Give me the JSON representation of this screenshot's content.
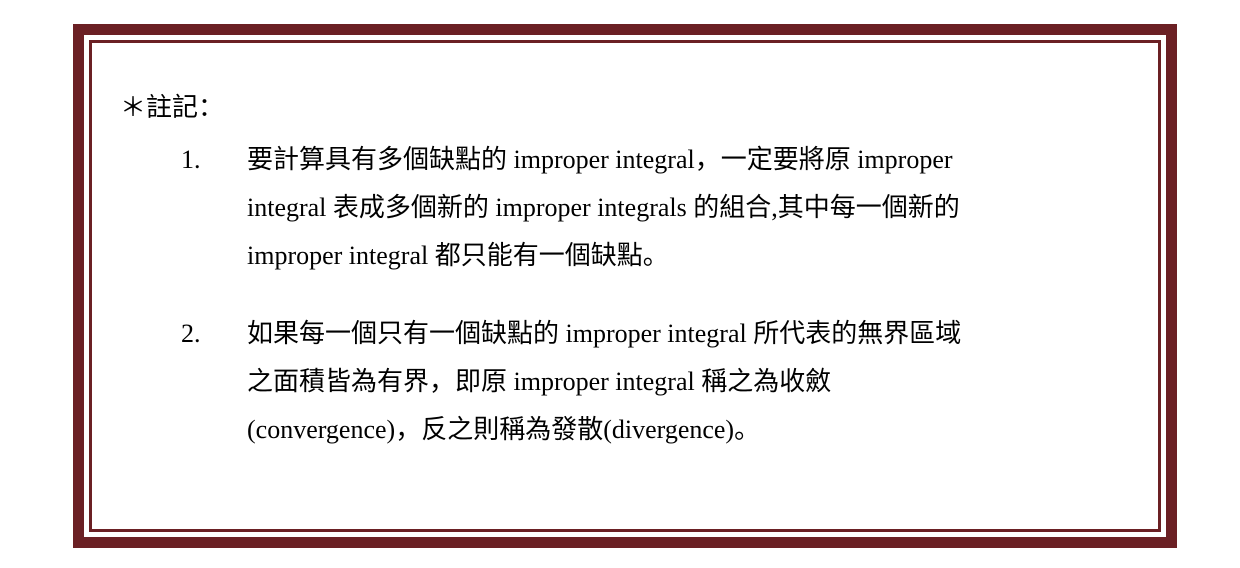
{
  "note": {
    "heading": "＊註記：",
    "items": [
      {
        "number": "1.",
        "lines": [
          "要計算具有多個缺點的 improper integral，一定要將原 improper",
          "integral 表成多個新的 improper integrals 的組合,其中每一個新的",
          "improper integral 都只能有一個缺點。"
        ]
      },
      {
        "number": "2.",
        "lines": [
          "如果每一個只有一個缺點的 improper integral 所代表的無界區域",
          "之面積皆為有界，即原 improper integral 稱之為收斂",
          "(convergence)，反之則稱為發散(divergence)。"
        ]
      }
    ]
  },
  "colors": {
    "border": "#6b2024",
    "background": "#ffffff",
    "text": "#000000"
  }
}
